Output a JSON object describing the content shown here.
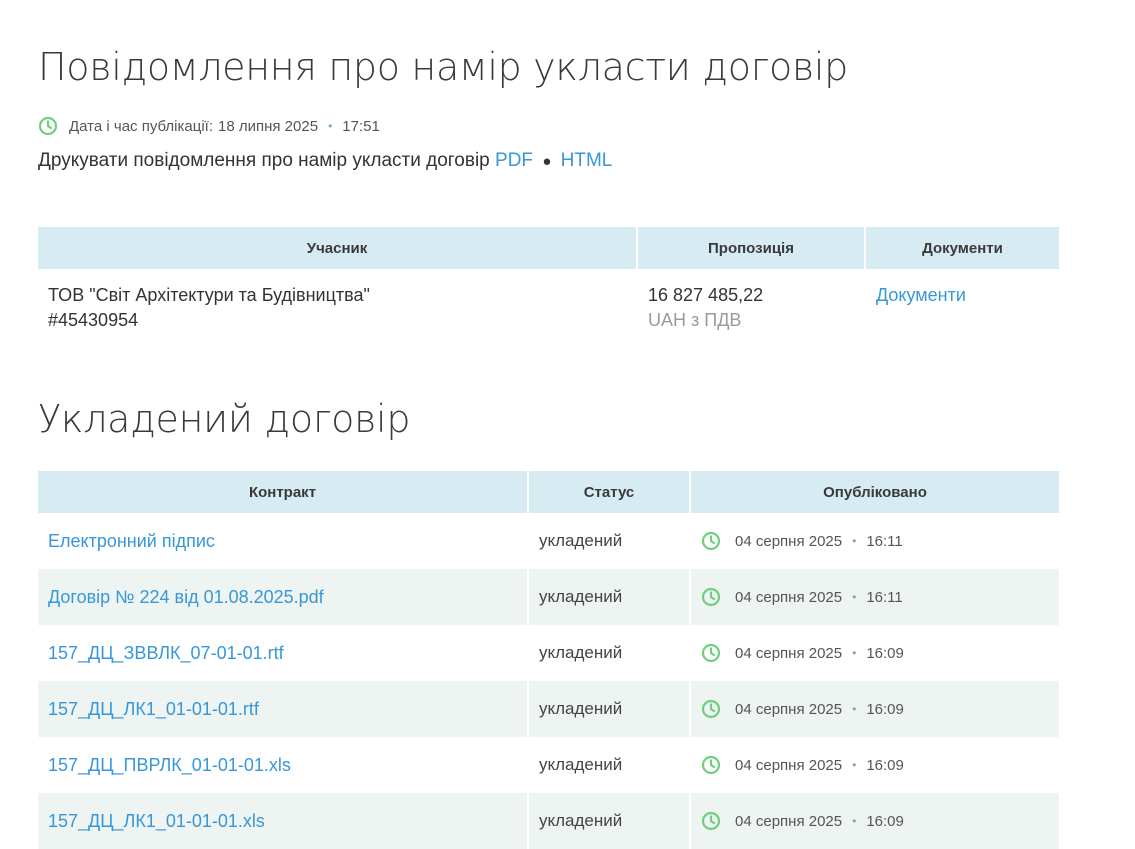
{
  "notice": {
    "title": "Повідомлення про намір укласти договір",
    "published_label": "Дата і час публікації:",
    "published_date": "18 липня 2025",
    "published_time": "17:51",
    "print_text": "Друкувати повідомлення про намір укласти договір",
    "print_pdf": "PDF",
    "print_html": "HTML",
    "bullet": "●"
  },
  "participants_table": {
    "headers": [
      "Учасник",
      "Пропозиція",
      "Документи"
    ],
    "rows": [
      {
        "name": "ТОВ \"Світ Архітектури та Будівництва\"",
        "id": "#45430954",
        "amount": "16 827 485,22",
        "currency": "UAH з ПДВ",
        "documents_link": "Документи"
      }
    ]
  },
  "contract": {
    "title": "Укладений договір",
    "headers": [
      "Контракт",
      "Статус",
      "Опубліковано"
    ],
    "rows": [
      {
        "name": "Електронний підпис",
        "status": "укладений",
        "date": "04 серпня 2025",
        "time": "16:11"
      },
      {
        "name": "Договір № 224 від 01.08.2025.pdf",
        "status": "укладений",
        "date": "04 серпня 2025",
        "time": "16:11"
      },
      {
        "name": "157_ДЦ_ЗВВЛК_07-01-01.rtf",
        "status": "укладений",
        "date": "04 серпня 2025",
        "time": "16:09"
      },
      {
        "name": "157_ДЦ_ЛК1_01-01-01.rtf",
        "status": "укладений",
        "date": "04 серпня 2025",
        "time": "16:09"
      },
      {
        "name": "157_ДЦ_ПВРЛК_01-01-01.xls",
        "status": "укладений",
        "date": "04 серпня 2025",
        "time": "16:09"
      },
      {
        "name": "157_ДЦ_ЛК1_01-01-01.xls",
        "status": "укладений",
        "date": "04 серпня 2025",
        "time": "16:09"
      }
    ]
  },
  "icons": {
    "clock": "clock-icon"
  },
  "colors": {
    "link": "#3797d8",
    "header_bg": "#d6ebf2",
    "clock": "#6fcf7f",
    "row_alt": "#eef4f1"
  }
}
